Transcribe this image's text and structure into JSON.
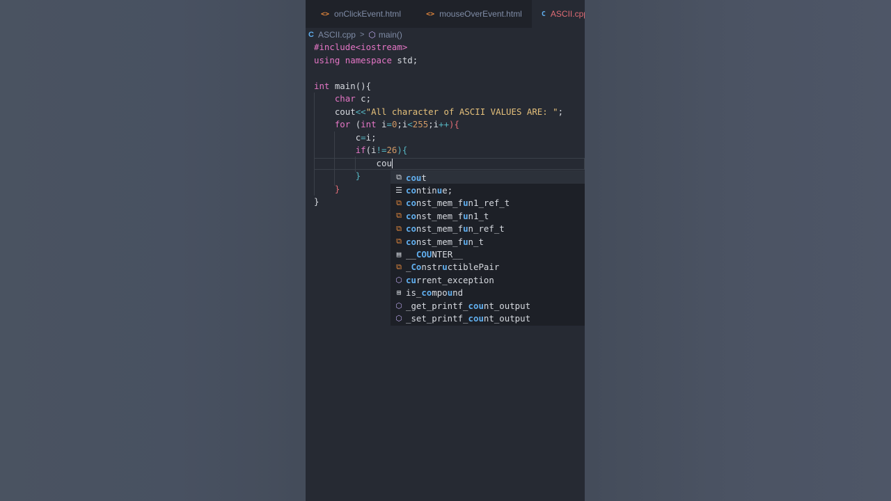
{
  "tabs": [
    {
      "label": "onClickEvent.html",
      "icon": "html-icon"
    },
    {
      "label": "mouseOverEvent.html",
      "icon": "html-icon"
    },
    {
      "label": "ASCII.cpp",
      "icon": "cpp-icon"
    }
  ],
  "breadcrumb": {
    "file": "ASCII.cpp",
    "symbol": "main()"
  },
  "code": {
    "l1": "#include<iostream>",
    "l2_kw": "using",
    "l2_kw2": "namespace",
    "l2_rest": " std;",
    "l4_type": "int",
    "l4_rest": " main(){",
    "l5_type": "char",
    "l5_rest": " c;",
    "l6_a": "cout",
    "l6_op": "<<",
    "l6_str": "\"All character of ASCII VALUES ARE: \"",
    "l6_end": ";",
    "l7_kw": "for",
    "l7_p1": " (",
    "l7_int": "int",
    "l7_p2": " i",
    "l7_eq": "=",
    "l7_n0": "0",
    "l7_p3": ";i",
    "l7_lt": "<",
    "l7_n255": "255",
    "l7_p4": ";i",
    "l7_inc": "++",
    "l7_p5": "){",
    "l8_a": "c",
    "l8_eq": "=",
    "l8_b": "i;",
    "l9_kw": "if",
    "l9_a": "(i",
    "l9_ne": "!=",
    "l9_n": "26",
    "l9_b": "){",
    "l10": "cou",
    "l11": "}",
    "l12": "}",
    "l13": "}"
  },
  "suggestions": [
    {
      "icon": "variable-icon",
      "label": "cout",
      "selected": true
    },
    {
      "icon": "snippet-icon",
      "label": "continue;",
      "selected": false
    },
    {
      "icon": "class-icon",
      "label": "const_mem_fun1_ref_t",
      "selected": false
    },
    {
      "icon": "class-icon",
      "label": "const_mem_fun1_t",
      "selected": false
    },
    {
      "icon": "class-icon",
      "label": "const_mem_fun_ref_t",
      "selected": false
    },
    {
      "icon": "class-icon",
      "label": "const_mem_fun_t",
      "selected": false
    },
    {
      "icon": "constant-icon",
      "label": "__COUNTER__",
      "selected": false
    },
    {
      "icon": "class-icon",
      "label": "_ConstructiblePair",
      "selected": false
    },
    {
      "icon": "function-icon",
      "label": "current_exception",
      "selected": false
    },
    {
      "icon": "struct-icon",
      "label": "is_compound",
      "selected": false
    },
    {
      "icon": "function-icon",
      "label": "_get_printf_count_output",
      "selected": false
    },
    {
      "icon": "function-icon",
      "label": "_set_printf_count_output",
      "selected": false
    }
  ]
}
